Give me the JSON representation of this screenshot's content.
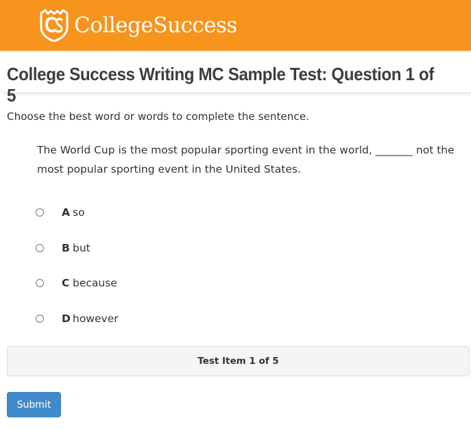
{
  "header": {
    "logo_text": "CollegeSuccess",
    "logo_icon": "cs-shield-icon",
    "background_color": "#f7941d"
  },
  "title": "College Success Writing MC Sample Test: Question 1 of 5",
  "instruction": "Choose the best word or words to complete the sentence.",
  "question": {
    "stem": "The World Cup is the most popular sporting event in the world, _______ not the most popular sporting event in the United States."
  },
  "options": [
    {
      "letter": "A",
      "text": "so"
    },
    {
      "letter": "B",
      "text": "but"
    },
    {
      "letter": "C",
      "text": "because"
    },
    {
      "letter": "D",
      "text": "however"
    }
  ],
  "status": "Test Item 1 of 5",
  "submit_label": "Submit",
  "accent_color": "#428bca"
}
